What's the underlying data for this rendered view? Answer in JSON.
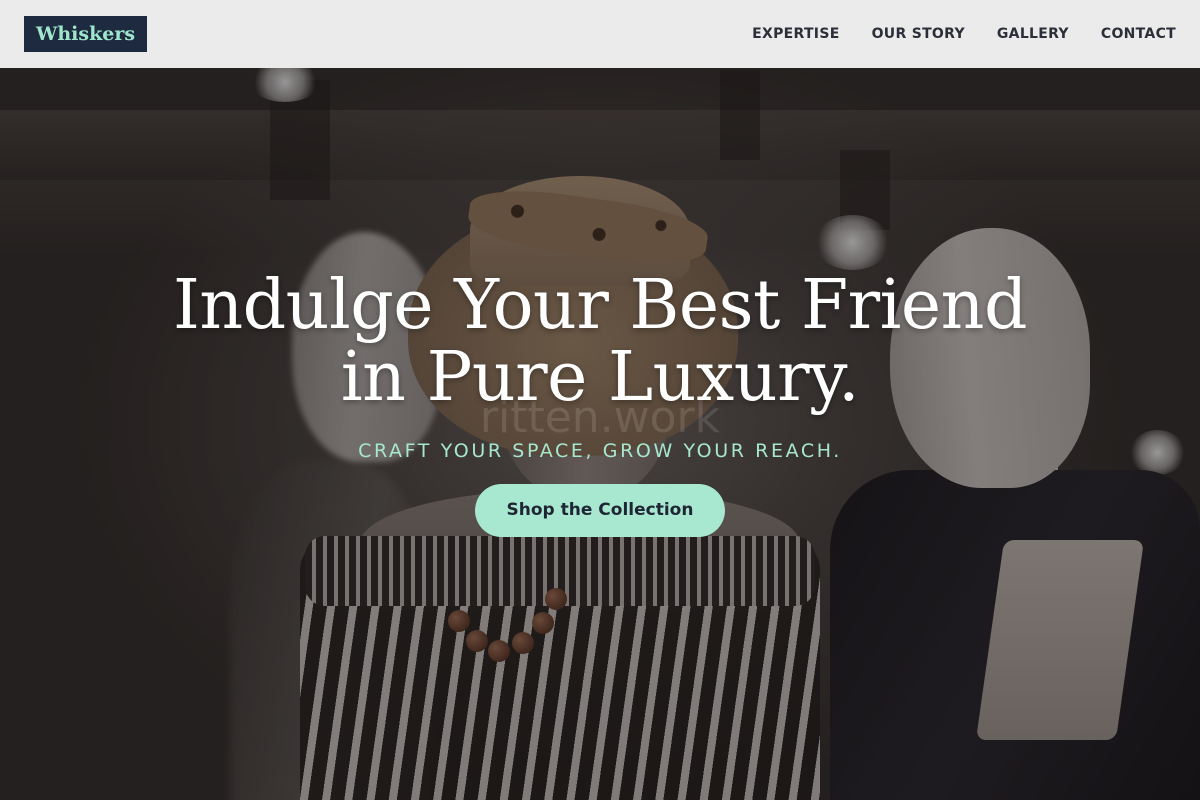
{
  "brand": {
    "logo_text": "Whiskers",
    "logo_bg_color": "#1d2a40",
    "logo_text_color": "#9fe6cc"
  },
  "nav": {
    "items": [
      {
        "label": "EXPERTISE"
      },
      {
        "label": "OUR STORY"
      },
      {
        "label": "GALLERY"
      },
      {
        "label": "CONTACT"
      }
    ]
  },
  "hero": {
    "title_line1": "Indulge Your Best Friend",
    "title_line2": "in Pure Luxury.",
    "subtitle": "CRAFT YOUR SPACE, GROW YOUR REACH.",
    "cta_label": "Shop the Collection",
    "cta_color": "#a8e8d1",
    "subtitle_color": "#a7e6cf",
    "background_image": "store-mannequins-photo",
    "watermark_text": "ritten.work"
  }
}
